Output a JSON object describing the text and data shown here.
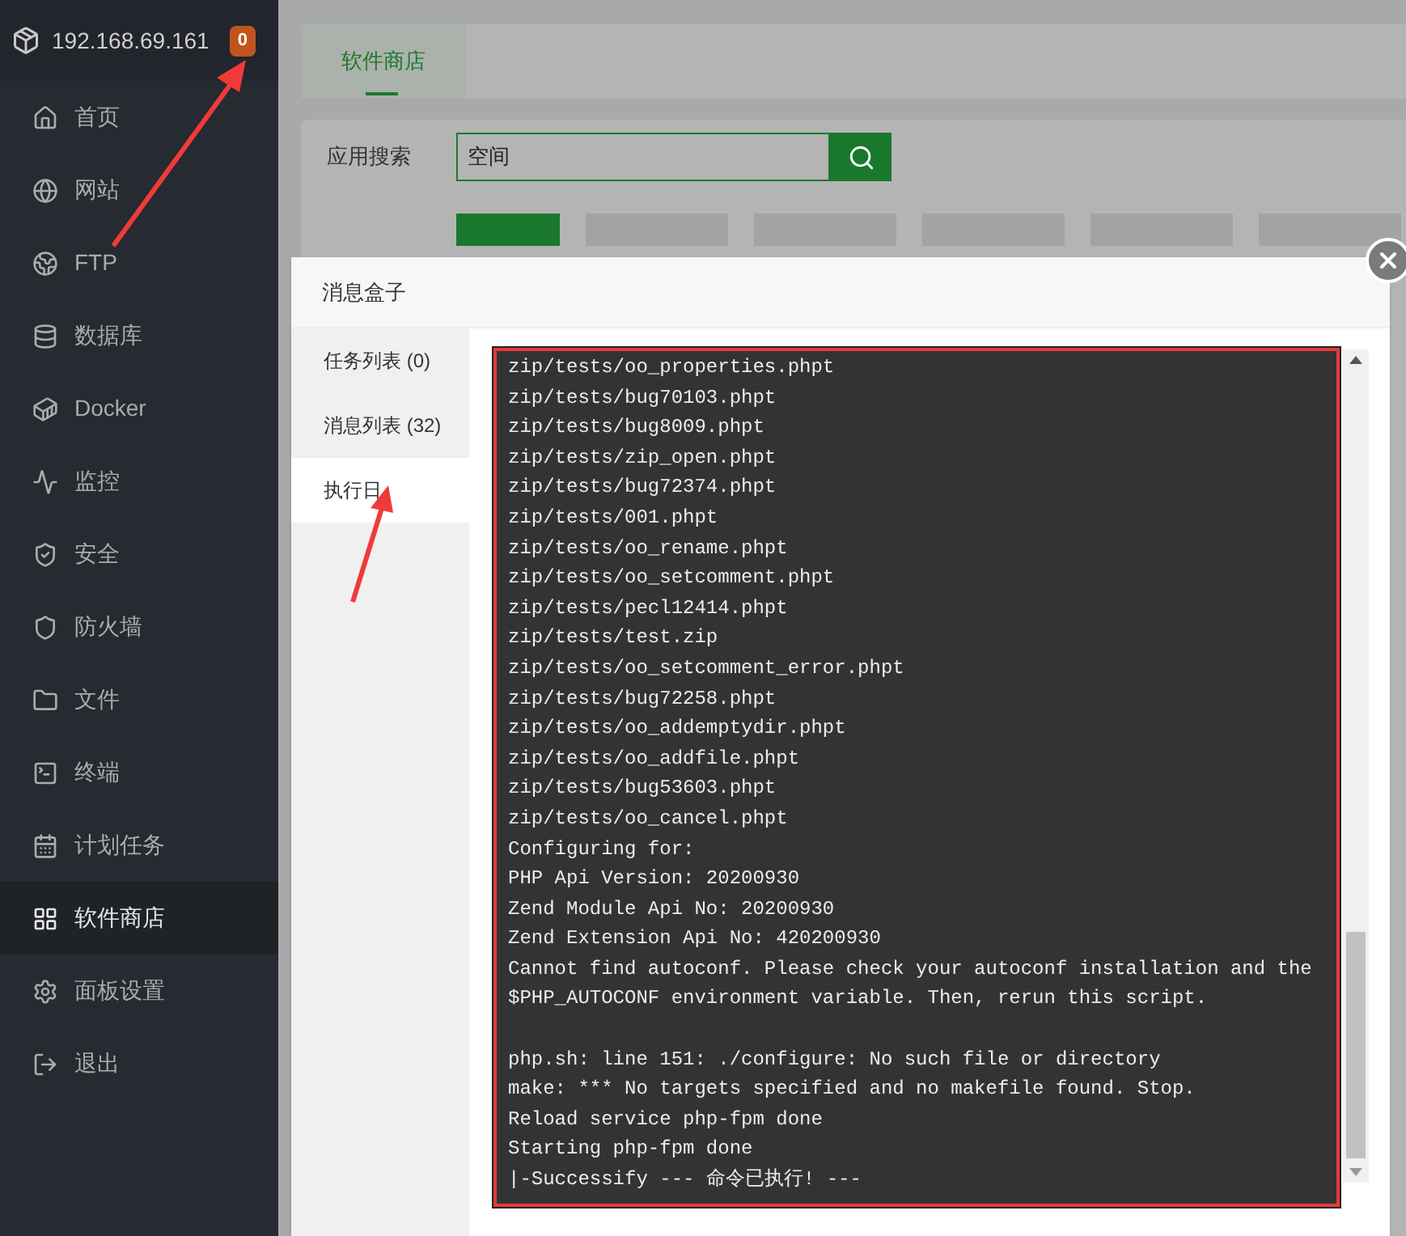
{
  "server": {
    "address": "192.168.69.161",
    "badge": "0"
  },
  "sidebar": {
    "items": [
      {
        "label": "首页",
        "selected": false
      },
      {
        "label": "网站",
        "selected": false
      },
      {
        "label": "FTP",
        "selected": false
      },
      {
        "label": "数据库",
        "selected": false
      },
      {
        "label": "Docker",
        "selected": false
      },
      {
        "label": "监控",
        "selected": false
      },
      {
        "label": "安全",
        "selected": false
      },
      {
        "label": "防火墙",
        "selected": false
      },
      {
        "label": "文件",
        "selected": false
      },
      {
        "label": "终端",
        "selected": false
      },
      {
        "label": "计划任务",
        "selected": false
      },
      {
        "label": "软件商店",
        "selected": true
      },
      {
        "label": "面板设置",
        "selected": false
      },
      {
        "label": "退出",
        "selected": false
      }
    ]
  },
  "top_tabs": [
    {
      "label": "软件商店",
      "selected": true
    }
  ],
  "search": {
    "label": "应用搜索",
    "value": "空间"
  },
  "category_tabs": [
    {
      "selected": true
    },
    {
      "selected": false
    },
    {
      "selected": false
    },
    {
      "selected": false
    },
    {
      "selected": false
    },
    {
      "selected": false
    }
  ],
  "modal": {
    "title": "消息盒子",
    "tabs": [
      {
        "label": "任务列表 (0)",
        "selected": false
      },
      {
        "label": "消息列表 (32)",
        "selected": false
      },
      {
        "label": "执行日",
        "selected": true
      }
    ],
    "log_blocks": [
      [
        "zip/tests/oo_properties.phpt",
        "zip/tests/bug70103.phpt",
        "zip/tests/bug8009.phpt",
        "zip/tests/zip_open.phpt",
        "zip/tests/bug72374.phpt",
        "zip/tests/001.phpt",
        "zip/tests/oo_rename.phpt",
        "zip/tests/oo_setcomment.phpt",
        "zip/tests/pecl12414.phpt",
        "zip/tests/test.zip",
        "zip/tests/oo_setcomment_error.phpt",
        "zip/tests/bug72258.phpt",
        "zip/tests/oo_addemptydir.phpt",
        "zip/tests/oo_addfile.phpt",
        "zip/tests/bug53603.phpt",
        "zip/tests/oo_cancel.phpt",
        "Configuring for:",
        "PHP Api Version: 20200930",
        "Zend Module Api No: 20200930",
        "Zend Extension Api No: 420200930",
        "Cannot find autoconf. Please check your autoconf installation and the",
        "$PHP_AUTOCONF environment variable. Then, rerun this script."
      ],
      [
        "php.sh: line 151: ./configure: No such file or directory",
        "make: *** No targets specified and no makefile found. Stop.",
        "Reload service php-fpm done",
        "Starting php-fpm done",
        "|-Successify --- 命令已执行! ---"
      ]
    ]
  }
}
